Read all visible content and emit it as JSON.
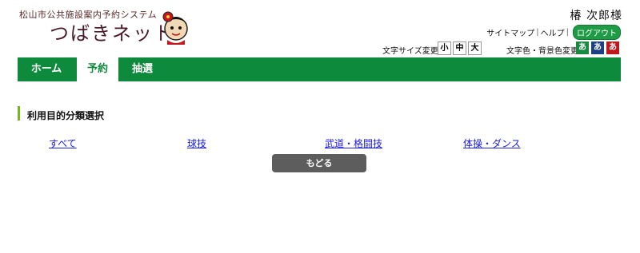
{
  "header": {
    "system_name": "松山市公共施設案内予約システム",
    "site_name": "つばきネット",
    "user_name": "椿 次郎様",
    "sitemap_label": "サイトマップ",
    "separator": "|",
    "help_label": "ヘルプ",
    "logout_label": "ログアウト",
    "font_size_label": "文字サイズ変更",
    "font_sizes": [
      "小",
      "中",
      "大"
    ],
    "color_label": "文字色・背景色変更",
    "color_options": [
      "あ",
      "あ",
      "あ"
    ],
    "colors": {
      "green": "#178a3f",
      "blue": "#1c3f8a",
      "red": "#c0171c"
    },
    "mascot_icon": "camellia-mascot-icon"
  },
  "nav": {
    "tabs": [
      {
        "label": "ホーム",
        "active": false
      },
      {
        "label": "予約",
        "active": true
      },
      {
        "label": "抽選",
        "active": false
      }
    ],
    "accent_color": "#0e8a3c"
  },
  "main": {
    "section_title": "利用目的分類選択",
    "categories": [
      "すべて",
      "球技",
      "武道・格闘技",
      "体操・ダンス"
    ],
    "back_label": "もどる"
  }
}
